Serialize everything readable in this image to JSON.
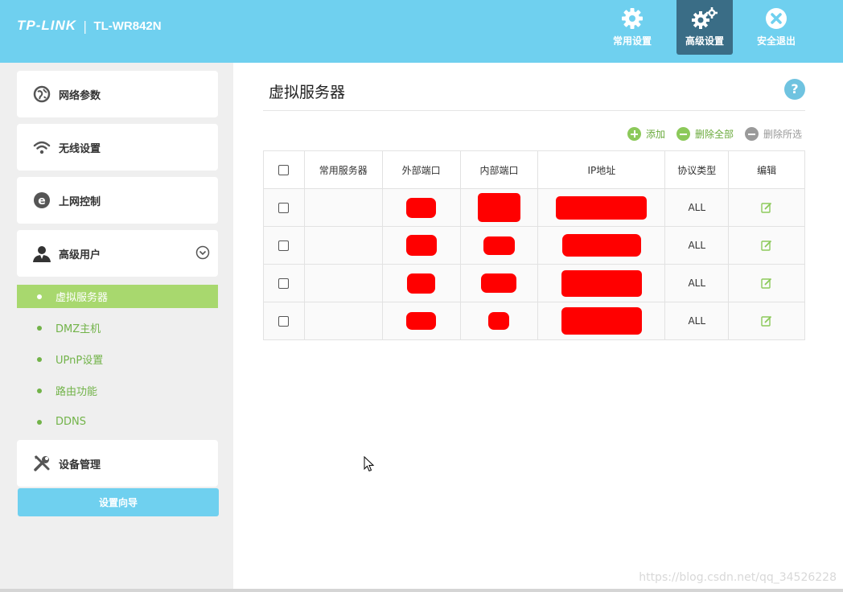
{
  "header": {
    "brand": "TP-LINK",
    "separator": "|",
    "model": "TL-WR842N",
    "nav": [
      {
        "label": "常用设置",
        "icon": "gear-icon"
      },
      {
        "label": "高级设置",
        "icon": "gears-icon",
        "active": true
      },
      {
        "label": "安全退出",
        "icon": "close-circle-icon"
      }
    ]
  },
  "sidebar": {
    "menu": [
      {
        "label": "网络参数",
        "icon": "globe-icon"
      },
      {
        "label": "无线设置",
        "icon": "wifi-icon"
      },
      {
        "label": "上网控制",
        "icon": "ie-icon"
      },
      {
        "label": "高级用户",
        "icon": "user-icon",
        "expanded": true
      },
      {
        "label": "设备管理",
        "icon": "tools-icon"
      }
    ],
    "submenu": [
      {
        "label": "虚拟服务器",
        "active": true
      },
      {
        "label": "DMZ主机"
      },
      {
        "label": "UPnP设置"
      },
      {
        "label": "路由功能"
      },
      {
        "label": "DDNS"
      }
    ],
    "wizard_label": "设置向导"
  },
  "main": {
    "title": "虚拟服务器",
    "help": "?",
    "toolbar": {
      "add": "添加",
      "delete_all": "删除全部",
      "delete_selected": "删除所选"
    },
    "table": {
      "columns": [
        "常用服务器",
        "外部端口",
        "内部端口",
        "IP地址",
        "协议类型",
        "编辑"
      ],
      "rows": [
        {
          "service": "",
          "external_port": "[redacted]",
          "internal_port": "[redacted]",
          "ip": "[redacted]",
          "protocol": "ALL"
        },
        {
          "service": "",
          "external_port": "[redacted]",
          "internal_port": "[redacted]",
          "ip": "[redacted]",
          "protocol": "ALL"
        },
        {
          "service": "",
          "external_port": "[redacted]",
          "internal_port": "[redacted]",
          "ip": "[redacted]",
          "protocol": "ALL"
        },
        {
          "service": "",
          "external_port": "[redacted]",
          "internal_port": "[redacted]",
          "ip": "[redacted]",
          "protocol": "ALL"
        }
      ]
    }
  },
  "watermark": "https://blog.csdn.net/qq_34526228",
  "colors": {
    "header": "#6fd0ef",
    "active_nav": "#3a6d86",
    "accent_green": "#a8d86e",
    "redaction": "#ff0000"
  }
}
